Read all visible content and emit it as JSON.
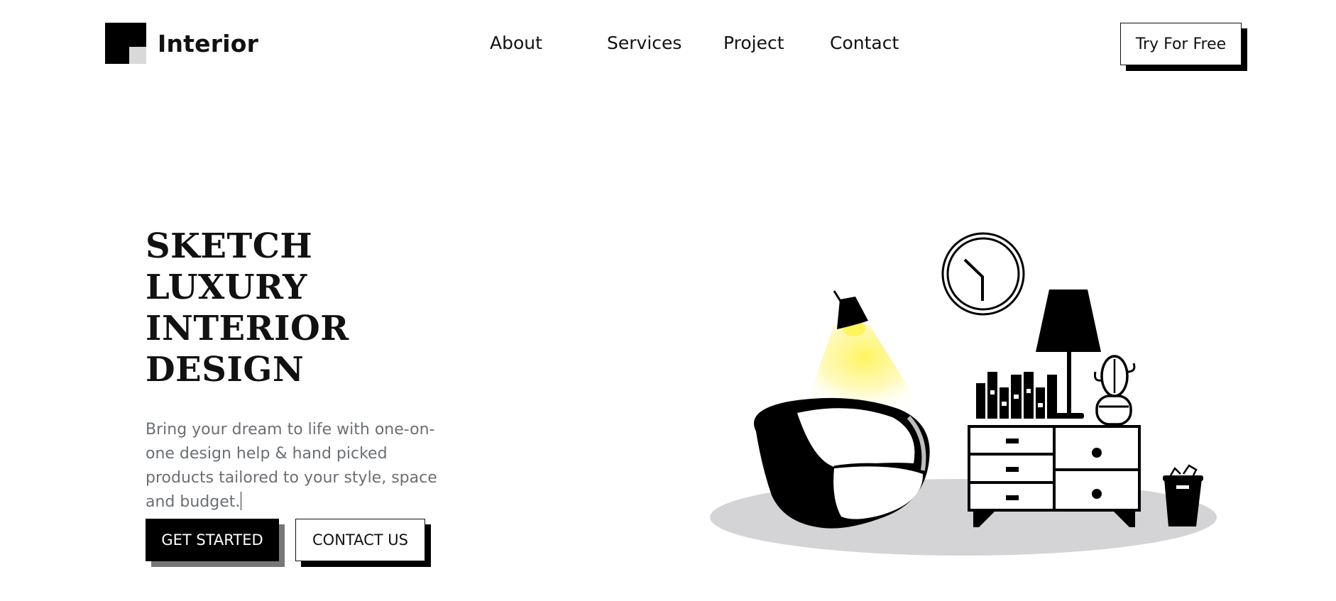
{
  "brand": {
    "name": "Interior"
  },
  "nav": {
    "items": [
      {
        "label": "About"
      },
      {
        "label": "Services"
      },
      {
        "label": "Project"
      },
      {
        "label": "Contact"
      }
    ],
    "cta_label": "Try For Free"
  },
  "hero": {
    "title_lines": [
      "SKETCH",
      "LUXURY",
      "INTERIOR",
      "DESIGN"
    ],
    "description": "Bring your dream to life with one-on-one design help & hand picked products tailored to your style, space and budget.",
    "primary_button": "GET STARTED",
    "secondary_button": "CONTACT US"
  },
  "colors": {
    "accent": "#000000",
    "lamp_light": "#fff45c",
    "floor": "#d4d4d6",
    "text_muted": "#6b6f73"
  },
  "icons": {
    "logo": "square-logo-icon",
    "illustration": "living-room-illustration"
  }
}
